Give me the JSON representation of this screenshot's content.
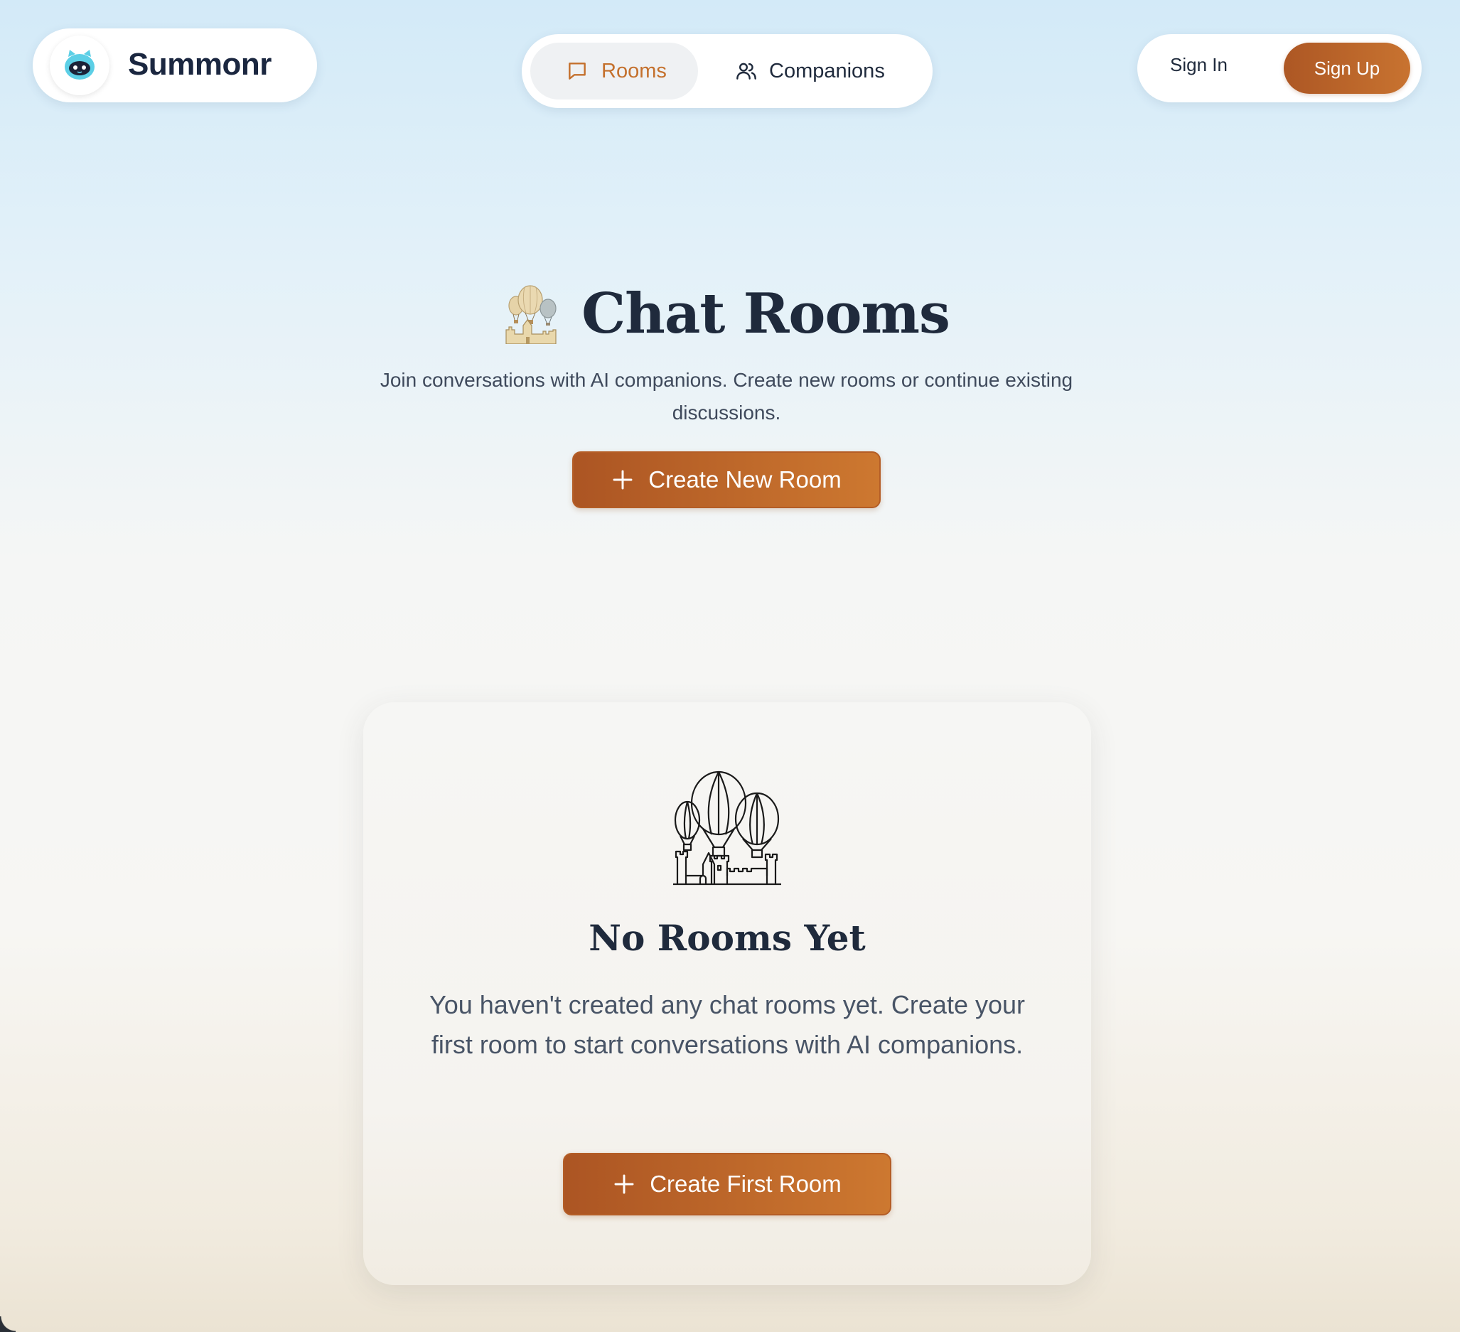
{
  "brand": {
    "name": "Summonr",
    "logo_icon": "robot-cat-icon"
  },
  "nav": {
    "items": [
      {
        "label": "Rooms",
        "icon": "chat-bubble-icon",
        "active": true
      },
      {
        "label": "Companions",
        "icon": "users-icon",
        "active": false
      }
    ]
  },
  "auth": {
    "sign_in": "Sign In",
    "sign_up": "Sign Up"
  },
  "hero": {
    "emoji_icon": "balloon-castle-icon",
    "title": "Chat Rooms",
    "subtitle": "Join conversations with AI companions. Create new rooms or continue existing discussions.",
    "create_button": "Create New Room"
  },
  "empty_state": {
    "illustration": "balloon-castle-line-icon",
    "title": "No Rooms Yet",
    "text": "You haven't created any chat rooms yet. Create your first room to start conversations with AI companions.",
    "button": "Create First Room"
  },
  "colors": {
    "accent": "#c4702c",
    "button_start": "#ac5523",
    "button_end": "#cd7830",
    "heading": "#1f2a3c"
  }
}
